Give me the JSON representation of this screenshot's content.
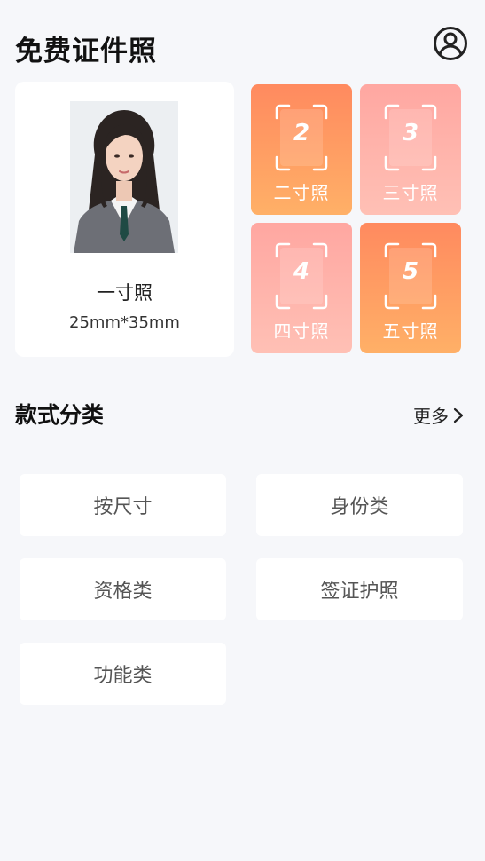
{
  "header": {
    "title": "免费证件照",
    "profile_icon": "user-circle-icon"
  },
  "featured": {
    "name": "一寸照",
    "size": "25mm*35mm"
  },
  "tiles": [
    {
      "num": "2",
      "label": "二寸照",
      "color": "#ff8a5f"
    },
    {
      "num": "3",
      "label": "三寸照",
      "color": "#ffa7a1"
    },
    {
      "num": "4",
      "label": "四寸照",
      "color": "#ffa7a1"
    },
    {
      "num": "5",
      "label": "五寸照",
      "color": "#ff8a5f"
    }
  ],
  "section": {
    "title": "款式分类",
    "more": "更多"
  },
  "categories": [
    {
      "label": "按尺寸"
    },
    {
      "label": "身份类"
    },
    {
      "label": "资格类"
    },
    {
      "label": "签证护照"
    },
    {
      "label": "功能类"
    }
  ],
  "colors": {
    "background": "#f6f7fa",
    "orange": "#ff8a5f",
    "pink": "#ffa7a1"
  }
}
